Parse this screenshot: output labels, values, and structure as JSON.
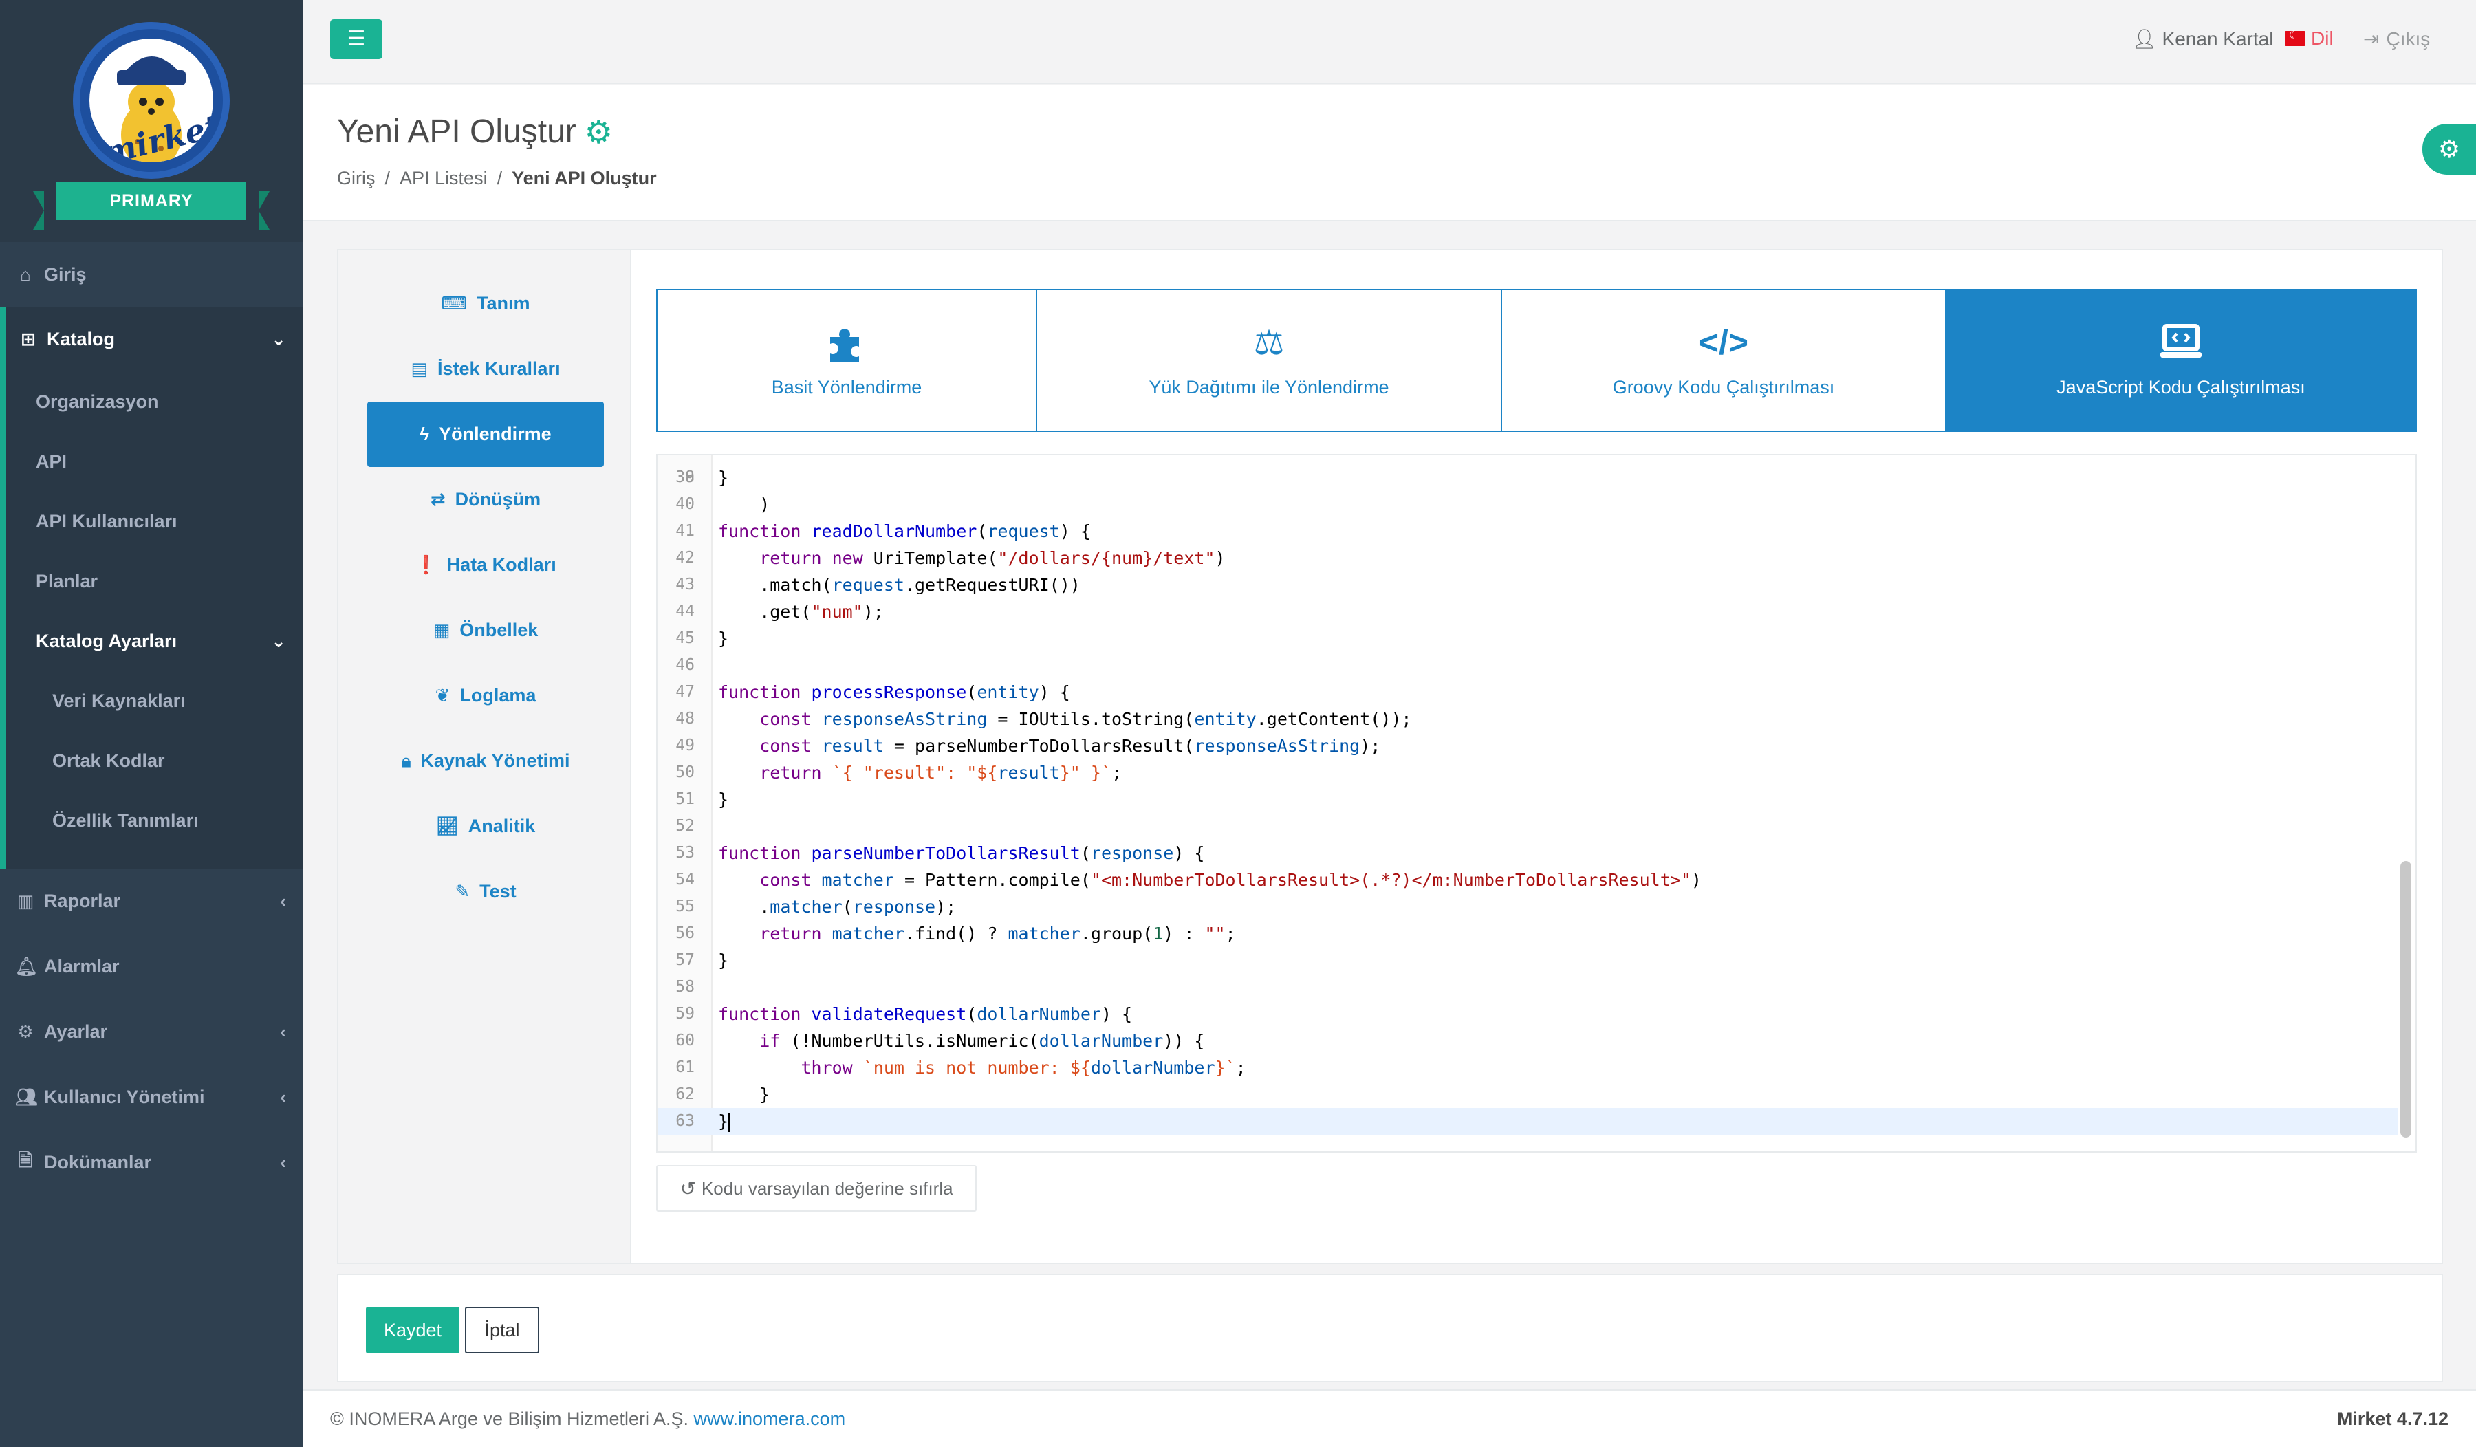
{
  "brand": {
    "badge": "PRIMARY",
    "logo_text": "mirket"
  },
  "sidebar": {
    "items": [
      {
        "label": "Giriş",
        "icon": "home-icon"
      },
      {
        "label": "Katalog",
        "icon": "sitemap-icon"
      },
      {
        "label": "Raporlar",
        "icon": "bar-chart-icon"
      },
      {
        "label": "Alarmlar",
        "icon": "bell-icon"
      },
      {
        "label": "Ayarlar",
        "icon": "gears-icon"
      },
      {
        "label": "Kullanıcı Yönetimi",
        "icon": "users-icon"
      },
      {
        "label": "Dokümanlar",
        "icon": "file-icon"
      }
    ],
    "katalog_sub": [
      "Organizasyon",
      "API",
      "API Kullanıcıları",
      "Planlar",
      "Katalog Ayarları"
    ],
    "katalog_ayarlari_sub": [
      "Veri Kaynakları",
      "Ortak Kodlar",
      "Özellik Tanımları"
    ]
  },
  "topbar": {
    "user": "Kenan Kartal",
    "language": "Dil",
    "logout": "Çıkış"
  },
  "page": {
    "title": "Yeni API Oluştur",
    "breadcrumb": [
      "Giriş",
      "API Listesi",
      "Yeni API Oluştur"
    ]
  },
  "left_menu": {
    "items": [
      {
        "label": "Tanım",
        "icon": "keyboard-icon"
      },
      {
        "label": "İstek Kuralları",
        "icon": "file-text-icon"
      },
      {
        "label": "Yönlendirme",
        "icon": "bolt-icon"
      },
      {
        "label": "Dönüşüm",
        "icon": "exchange-icon"
      },
      {
        "label": "Hata Kodları",
        "icon": "exclamation-circle-icon"
      },
      {
        "label": "Önbellek",
        "icon": "memory-icon"
      },
      {
        "label": "Loglama",
        "icon": "leaf-icon"
      },
      {
        "label": "Kaynak Yönetimi",
        "icon": "lock-icon"
      },
      {
        "label": "Analitik",
        "icon": "line-chart-icon"
      },
      {
        "label": "Test",
        "icon": "pencil-icon"
      }
    ],
    "active_index": 2
  },
  "routing_tabs": [
    {
      "label": "Basit Yönlendirme",
      "icon": "puzzle-icon",
      "active": false
    },
    {
      "label": "Yük Dağıtımı ile Yönlendirme",
      "icon": "balance-scale-icon",
      "active": false
    },
    {
      "label": "Groovy Kodu Çalıştırılması",
      "icon": "code-icon",
      "active": false
    },
    {
      "label": "JavaScript Kodu Çalıştırılması",
      "icon": "laptop-code-icon",
      "active": true
    }
  ],
  "editor": {
    "partial_top_line": "38",
    "lines": [
      {
        "n": "39",
        "code": "}"
      },
      {
        "n": "40",
        "code": ""
      },
      {
        "n": "41",
        "code": "function readDollarNumber(request) {"
      },
      {
        "n": "42",
        "code": "    return new UriTemplate(\"/dollars/{num}/text\")"
      },
      {
        "n": "43",
        "code": "    .match(request.getRequestURI())"
      },
      {
        "n": "44",
        "code": "    .get(\"num\");"
      },
      {
        "n": "45",
        "code": "}"
      },
      {
        "n": "46",
        "code": ""
      },
      {
        "n": "47",
        "code": "function processResponse(entity) {"
      },
      {
        "n": "48",
        "code": "    const responseAsString = IOUtils.toString(entity.getContent());"
      },
      {
        "n": "49",
        "code": "    const result = parseNumberToDollarsResult(responseAsString);"
      },
      {
        "n": "50",
        "code": "    return `{ \"result\": \"${result}\" }`;"
      },
      {
        "n": "51",
        "code": "}"
      },
      {
        "n": "52",
        "code": ""
      },
      {
        "n": "53",
        "code": "function parseNumberToDollarsResult(response) {"
      },
      {
        "n": "54",
        "code": "    const matcher = Pattern.compile(\"<m:NumberToDollarsResult>(.*?)</m:NumberToDollarsResult>\")"
      },
      {
        "n": "55",
        "code": "    .matcher(response);"
      },
      {
        "n": "56",
        "code": "    return matcher.find() ? matcher.group(1) : \"\";"
      },
      {
        "n": "57",
        "code": "}"
      },
      {
        "n": "58",
        "code": ""
      },
      {
        "n": "59",
        "code": "function validateRequest(dollarNumber) {"
      },
      {
        "n": "60",
        "code": "    if (!NumberUtils.isNumeric(dollarNumber)) {"
      },
      {
        "n": "61",
        "code": "        throw `num is not number: ${dollarNumber}`;"
      },
      {
        "n": "62",
        "code": "    }"
      },
      {
        "n": "63",
        "code": "}"
      }
    ],
    "reset_label": "Kodu varsayılan değerine sıfırla"
  },
  "actions": {
    "save": "Kaydet",
    "cancel": "İptal"
  },
  "footer": {
    "copyright": "© INOMERA Arge ve Bilişim Hizmetleri A.Ş.",
    "link": "www.inomera.com",
    "version": "Mirket 4.7.12"
  },
  "colors": {
    "primary": "#1ab394",
    "info": "#1c84c6",
    "sidebar": "#2f4050"
  }
}
